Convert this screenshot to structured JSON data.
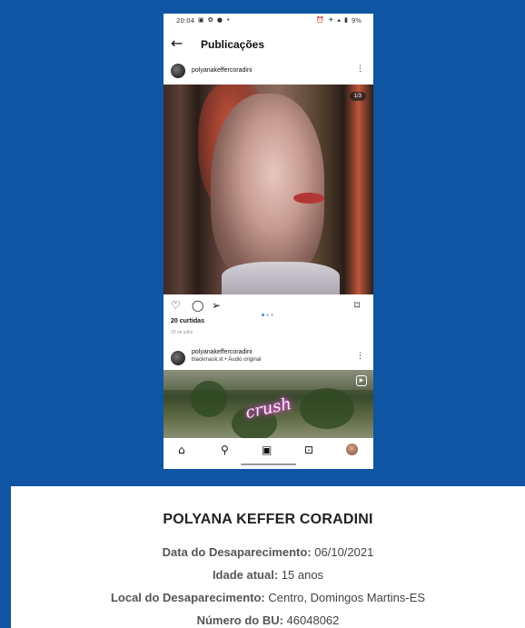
{
  "phone": {
    "status_bar": {
      "time": "20:04",
      "left_icons": "▣ ✿ ● •",
      "right_icons": "⏰ ✈ ▴ ▮",
      "battery": "9%"
    },
    "app_bar": {
      "title": "Publicações"
    },
    "post1": {
      "username": "polyanakeffercoradini",
      "photo_counter": "1/3",
      "carousel": {
        "total": 3,
        "active": 1
      },
      "likes": "20 curtidas",
      "date": "20 de julho"
    },
    "post2": {
      "username": "polyanakeffercoradini",
      "subtitle": "blackmask.xt • Áudio original",
      "overlay_text": "crush"
    },
    "icons": {
      "back": "arrow-left",
      "more": "kebab-vertical",
      "like": "heart-outline",
      "comment": "comment-outline",
      "share": "send-outline",
      "save": "bookmark-outline",
      "reel": "reel",
      "nav": [
        "home",
        "search",
        "reels",
        "shop",
        "profile"
      ]
    }
  },
  "card": {
    "name": "POLYANA KEFFER CORADINI",
    "rows": [
      {
        "label": "Data do Desaparecimento:",
        "value": " 06/10/2021"
      },
      {
        "label": "Idade atual:",
        "value": " 15 anos"
      },
      {
        "label": "Local do Desaparecimento:",
        "value": " Centro, Domingos Martins-ES"
      },
      {
        "label": "Número do BU:",
        "value": " 46048062"
      }
    ]
  },
  "colors": {
    "background": "#0f55a3",
    "card": "#ffffff",
    "accent_dot": "#2c8ef0"
  }
}
